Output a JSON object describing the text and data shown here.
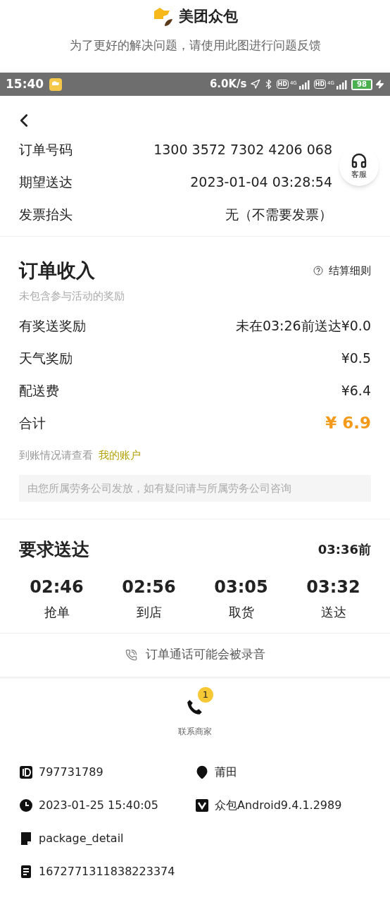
{
  "banner": {
    "app_name": "美团众包",
    "note": "为了更好的解决问题，请使用此图进行问题反馈"
  },
  "status_bar": {
    "time": "15:40",
    "speed": "6.0K/s",
    "networks": [
      {
        "badge": "HD",
        "type": "4G"
      },
      {
        "badge": "HD",
        "type": "4G"
      }
    ],
    "battery": "98"
  },
  "order": {
    "rows": [
      {
        "label": "订单号码",
        "value": "1300 3572 7302 4206 068"
      },
      {
        "label": "期望送达",
        "value": "2023-01-04 03:28:54"
      },
      {
        "label": "发票抬头",
        "value": "无（不需要发票）"
      }
    ],
    "service_button": "客服"
  },
  "income": {
    "title": "订单收入",
    "rules_link": "结算细则",
    "subtitle": "未包含参与活动的奖励",
    "rows": [
      {
        "label": "有奖送奖励",
        "value": "未在03:26前送达¥0.0",
        "kind": "normal"
      },
      {
        "label": "天气奖励",
        "value": "¥0.5",
        "kind": "normal"
      },
      {
        "label": "配送费",
        "value": "¥6.4",
        "kind": "normal"
      },
      {
        "label": "合计",
        "value": "¥ 6.9",
        "kind": "total"
      }
    ],
    "account_hint": "到账情况请查看",
    "account_link": "我的账户",
    "notice": "由您所属劳务公司发放，如有疑问请与所属劳务公司咨询"
  },
  "delivery": {
    "title": "要求送达",
    "deadline": "03:36前",
    "steps": [
      {
        "time": "02:46",
        "label": "抢单"
      },
      {
        "time": "02:56",
        "label": "到店"
      },
      {
        "time": "03:05",
        "label": "取货"
      },
      {
        "time": "03:32",
        "label": "送达"
      }
    ]
  },
  "call_notice": "订单通话可能会被录音",
  "contact": {
    "label": "联系商家",
    "badge": "1"
  },
  "info": [
    {
      "kind": "id",
      "text": "797731789"
    },
    {
      "kind": "location",
      "text": "莆田"
    },
    {
      "kind": "time",
      "text": "2023-01-25 15:40:05"
    },
    {
      "kind": "version",
      "text": "众包Android9.4.1.2989"
    },
    {
      "kind": "page",
      "text": "package_detail"
    },
    {
      "kind": "blank"
    },
    {
      "kind": "doc",
      "text": "1672771311838223374"
    }
  ]
}
